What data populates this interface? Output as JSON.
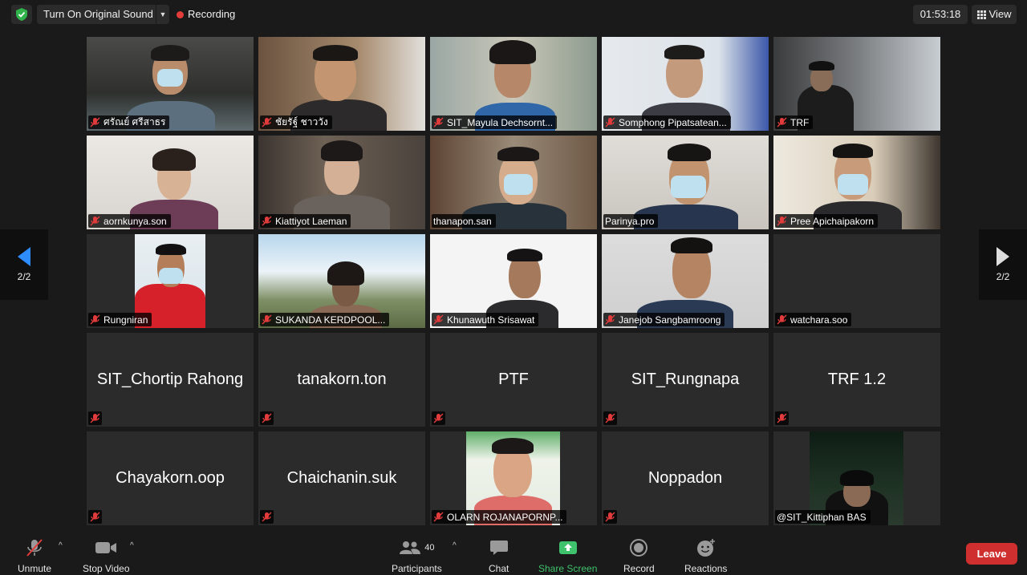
{
  "topbar": {
    "sound_label": "Turn On Original Sound",
    "recording_label": "Recording",
    "timer": "01:53:18",
    "view_label": "View"
  },
  "pagination": {
    "left": "2/2",
    "right": "2/2"
  },
  "participants": [
    {
      "name": "ศรัณย์ ศรีสาธร"
    },
    {
      "name": "ชัยรัฐ์ ชาววัง"
    },
    {
      "name": "SIT_Mayula Dechsornt..."
    },
    {
      "name": "Somphong Pipatsatean..."
    },
    {
      "name": "TRF"
    },
    {
      "name": "aornkunya.son"
    },
    {
      "name": "Kiattiyot Laeman"
    },
    {
      "name": "thanapon.san"
    },
    {
      "name": "Parinya.pro"
    },
    {
      "name": "Pree Apichaipakorn"
    },
    {
      "name": "Rungniran"
    },
    {
      "name": "SUKANDA KERDPOOL..."
    },
    {
      "name": "Khunawuth Srisawat"
    },
    {
      "name": "Janejob Sangbamroong"
    },
    {
      "name": "watchara.soo"
    },
    {
      "name": "SIT_Chortip Rahong"
    },
    {
      "name": "tanakorn.ton"
    },
    {
      "name": "PTF"
    },
    {
      "name": "SIT_Rungnapa"
    },
    {
      "name": "TRF 1.2"
    },
    {
      "name": "Chayakorn.oop"
    },
    {
      "name": "Chaichanin.suk"
    },
    {
      "name": "OLARN ROJANAPORNP..."
    },
    {
      "name": "Noppadon"
    },
    {
      "name": "@SIT_Kittiphan BAS"
    }
  ],
  "toolbar": {
    "unmute": "Unmute",
    "stop_video": "Stop Video",
    "participants": "Participants",
    "participants_count": "40",
    "chat": "Chat",
    "share_screen": "Share Screen",
    "record": "Record",
    "reactions": "Reactions",
    "leave": "Leave"
  },
  "colors": {
    "accent_green": "#3ec26b",
    "leave_red": "#cf2f2f",
    "recording_red": "#e43b3b",
    "tile_bg": "#2b2b2b"
  }
}
